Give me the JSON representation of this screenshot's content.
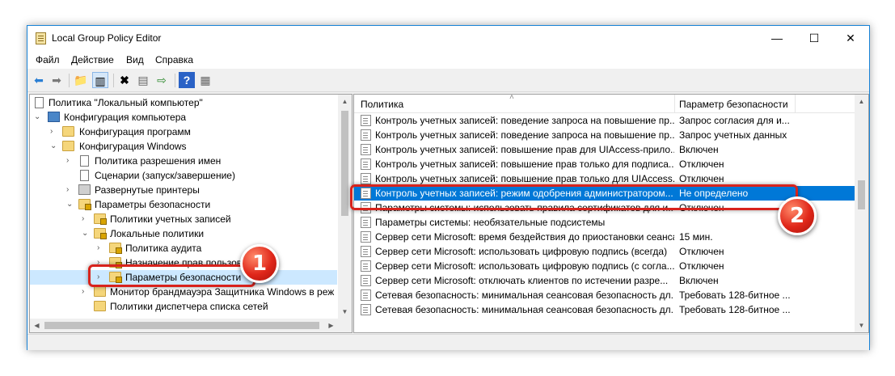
{
  "window": {
    "title": "Local Group Policy Editor",
    "min": "—",
    "max": "☐",
    "close": "✕"
  },
  "menu": [
    "Файл",
    "Действие",
    "Вид",
    "Справка"
  ],
  "tree": {
    "root": "Политика \"Локальный компьютер\"",
    "computer_config": "Конфигурация компьютера",
    "software_config": "Конфигурация программ",
    "windows_config": "Конфигурация Windows",
    "name_resolution": "Политика разрешения имен",
    "scripts": "Сценарии (запуск/завершение)",
    "printers": "Развернутые принтеры",
    "security_settings": "Параметры безопасности",
    "account_policies": "Политики учетных записей",
    "local_policies": "Локальные политики",
    "audit_policy": "Политика аудита",
    "user_rights": "Назначение прав пользователя",
    "security_options": "Параметры безопасности",
    "firewall": "Монитор брандмауэра Защитника Windows в реж",
    "network_list": "Политики диспетчера списка сетей"
  },
  "columns": {
    "policy": "Политика",
    "setting": "Параметр безопасности"
  },
  "policies": [
    {
      "name": "Контроль учетных записей: поведение запроса на повышение пр...",
      "value": "Запрос согласия для и..."
    },
    {
      "name": "Контроль учетных записей: поведение запроса на повышение пр...",
      "value": "Запрос учетных данных"
    },
    {
      "name": "Контроль учетных записей: повышение прав для UIAccess-прило...",
      "value": "Включен"
    },
    {
      "name": "Контроль учетных записей: повышение прав только для подписа...",
      "value": "Отключен"
    },
    {
      "name": "Контроль учетных записей: повышение прав только для UIAccess...",
      "value": "Отключен"
    },
    {
      "name": "Контроль учетных записей: режим одобрения администратором...",
      "value": "Не определено"
    },
    {
      "name": "Параметры системы: использовать правила сертификатов для и...",
      "value": "Отключен"
    },
    {
      "name": "Параметры системы: необязательные подсистемы",
      "value": ""
    },
    {
      "name": "Сервер сети Microsoft: время бездействия до приостановки сеанса",
      "value": "15 мин."
    },
    {
      "name": "Сервер сети Microsoft: использовать цифровую подпись (всегда)",
      "value": "Отключен"
    },
    {
      "name": "Сервер сети Microsoft: использовать цифровую подпись (с согла...",
      "value": "Отключен"
    },
    {
      "name": "Сервер сети Microsoft: отключать клиентов по истечении разре...",
      "value": "Включен"
    },
    {
      "name": "Сетевая безопасность: минимальная сеансовая безопасность дл...",
      "value": "Требовать 128-битное ..."
    },
    {
      "name": "Сетевая безопасность: минимальная сеансовая безопасность дл...",
      "value": "Требовать 128-битное ..."
    }
  ],
  "badges": {
    "one": "1",
    "two": "2"
  },
  "colors": {
    "accent": "#0078d7",
    "highlight": "#d8231c"
  }
}
